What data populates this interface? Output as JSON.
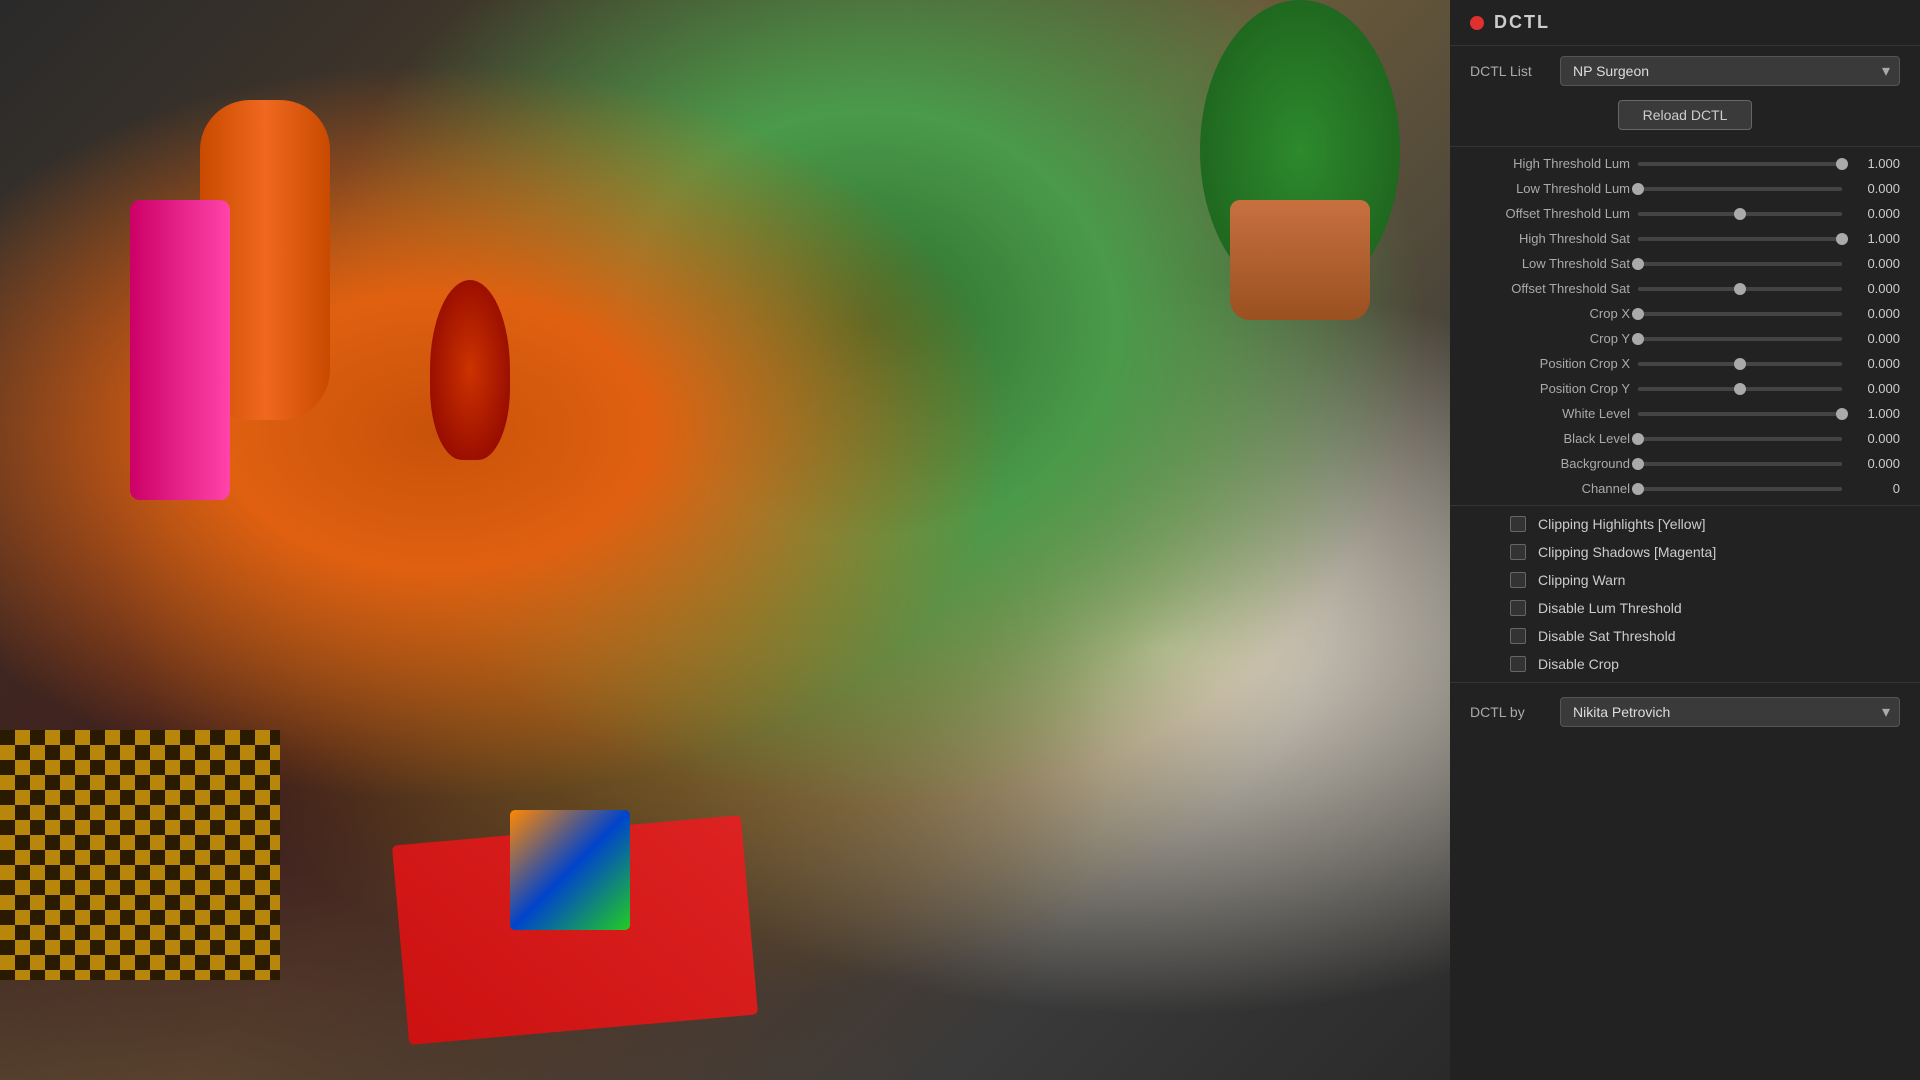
{
  "header": {
    "dot_color": "#e03030",
    "title": "DCTL"
  },
  "dctl_list": {
    "label": "DCTL List",
    "value": "NP Surgeon",
    "options": [
      "NP Surgeon"
    ]
  },
  "reload_btn": "Reload DCTL",
  "params": [
    {
      "id": "high-threshold-lum",
      "label": "High Threshold Lum",
      "value": "1.000",
      "thumb_pct": 100
    },
    {
      "id": "low-threshold-lum",
      "label": "Low Threshold Lum",
      "value": "0.000",
      "thumb_pct": 0
    },
    {
      "id": "offset-threshold-lum",
      "label": "Offset Threshold Lum",
      "value": "0.000",
      "thumb_pct": 50
    },
    {
      "id": "high-threshold-sat",
      "label": "High Threshold Sat",
      "value": "1.000",
      "thumb_pct": 100
    },
    {
      "id": "low-threshold-sat",
      "label": "Low Threshold Sat",
      "value": "0.000",
      "thumb_pct": 0
    },
    {
      "id": "offset-threshold-sat",
      "label": "Offset Threshold Sat",
      "value": "0.000",
      "thumb_pct": 50
    },
    {
      "id": "crop-x",
      "label": "Crop X",
      "value": "0.000",
      "thumb_pct": 0
    },
    {
      "id": "crop-y",
      "label": "Crop Y",
      "value": "0.000",
      "thumb_pct": 0
    },
    {
      "id": "position-crop-x",
      "label": "Position Crop X",
      "value": "0.000",
      "thumb_pct": 50
    },
    {
      "id": "position-crop-y",
      "label": "Position Crop Y",
      "value": "0.000",
      "thumb_pct": 50
    },
    {
      "id": "white-level",
      "label": "White Level",
      "value": "1.000",
      "thumb_pct": 100
    },
    {
      "id": "black-level",
      "label": "Black Level",
      "value": "0.000",
      "thumb_pct": 0
    },
    {
      "id": "background",
      "label": "Background",
      "value": "0.000",
      "thumb_pct": 0
    },
    {
      "id": "channel",
      "label": "Channel",
      "value": "0",
      "thumb_pct": 0
    }
  ],
  "checkboxes": [
    {
      "id": "clipping-highlights-yellow",
      "label": "Clipping Highlights [Yellow]",
      "checked": false
    },
    {
      "id": "clipping-shadows-magenta",
      "label": "Clipping Shadows [Magenta]",
      "checked": false
    },
    {
      "id": "clipping-warn",
      "label": "Clipping Warn",
      "checked": false
    },
    {
      "id": "disable-lum-threshold",
      "label": "Disable Lum Threshold",
      "checked": false
    },
    {
      "id": "disable-sat-threshold",
      "label": "Disable Sat Threshold",
      "checked": false
    },
    {
      "id": "disable-crop",
      "label": "Disable Crop",
      "checked": false
    }
  ],
  "dctl_by": {
    "label": "DCTL by",
    "value": "Nikita Petrovich",
    "options": [
      "Nikita Petrovich"
    ]
  }
}
